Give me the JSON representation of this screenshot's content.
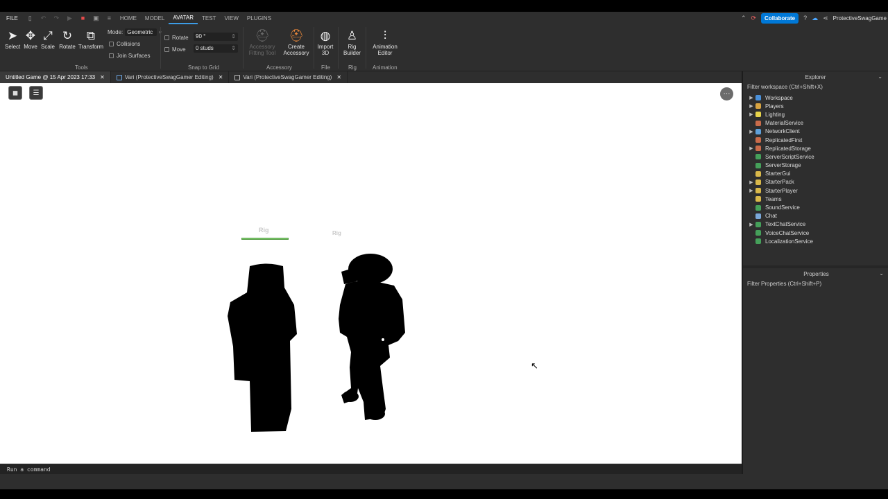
{
  "menubar": {
    "file": "FILE",
    "tabs": [
      "HOME",
      "MODEL",
      "AVATAR",
      "TEST",
      "VIEW",
      "PLUGINS"
    ],
    "collaborate": "Collaborate",
    "username": "ProtectiveSwagGame"
  },
  "ribbon": {
    "tools": {
      "select": "Select",
      "move": "Move",
      "scale": "Scale",
      "rotate": "Rotate",
      "transform": "Transform",
      "group": "Tools"
    },
    "mode_label": "Mode:",
    "mode_value": "Geometric",
    "collisions": "Collisions",
    "join_surfaces": "Join Surfaces",
    "snap": {
      "rotate_label": "Rotate",
      "rotate_value": "90 °",
      "move_label": "Move",
      "move_value": "0 studs",
      "group": "Snap to Grid"
    },
    "accessory": {
      "fitting_tool_1": "Accessory",
      "fitting_tool_2": "Fitting Tool",
      "create_1": "Create",
      "create_2": "Accessory",
      "group": "Accessory"
    },
    "file": {
      "import_1": "Import",
      "import_2": "3D",
      "group": "File"
    },
    "rig": {
      "builder_1": "Rig",
      "builder_2": "Builder",
      "group": "Rig"
    },
    "animation": {
      "editor_1": "Animation",
      "editor_2": "Editor",
      "group": "Animation"
    }
  },
  "doc_tabs": [
    "Untitled Game @ 15 Apr 2023 17:33",
    "Vari (ProtectiveSwagGamer Editing)",
    "Vari (ProtectiveSwagGamer Editing)"
  ],
  "viewport": {
    "rig_label_1": "Rig",
    "rig_label_2": "Rig"
  },
  "command_bar": {
    "placeholder": "Run a command"
  },
  "explorer": {
    "title": "Explorer",
    "filter": "Filter workspace (Ctrl+Shift+X)",
    "items": [
      {
        "label": "Workspace",
        "expandable": true,
        "color": "#4a90d9"
      },
      {
        "label": "Players",
        "expandable": true,
        "color": "#d9a441"
      },
      {
        "label": "Lighting",
        "expandable": true,
        "color": "#e8d44a"
      },
      {
        "label": "MaterialService",
        "expandable": false,
        "color": "#c96b4a"
      },
      {
        "label": "NetworkClient",
        "expandable": true,
        "color": "#5fa0d9"
      },
      {
        "label": "ReplicatedFirst",
        "expandable": false,
        "color": "#c96b4a"
      },
      {
        "label": "ReplicatedStorage",
        "expandable": true,
        "color": "#c96b4a"
      },
      {
        "label": "ServerScriptService",
        "expandable": false,
        "color": "#45a05a"
      },
      {
        "label": "ServerStorage",
        "expandable": false,
        "color": "#45a05a"
      },
      {
        "label": "StarterGui",
        "expandable": false,
        "color": "#d9b84a"
      },
      {
        "label": "StarterPack",
        "expandable": true,
        "color": "#d9b84a"
      },
      {
        "label": "StarterPlayer",
        "expandable": true,
        "color": "#d9b84a"
      },
      {
        "label": "Teams",
        "expandable": false,
        "color": "#d9b84a"
      },
      {
        "label": "SoundService",
        "expandable": false,
        "color": "#45a05a"
      },
      {
        "label": "Chat",
        "expandable": false,
        "color": "#7aa8d9"
      },
      {
        "label": "TextChatService",
        "expandable": true,
        "color": "#45a05a"
      },
      {
        "label": "VoiceChatService",
        "expandable": false,
        "color": "#45a05a"
      },
      {
        "label": "LocalizationService",
        "expandable": false,
        "color": "#45a05a"
      }
    ]
  },
  "properties": {
    "title": "Properties",
    "filter": "Filter Properties (Ctrl+Shift+P)"
  }
}
